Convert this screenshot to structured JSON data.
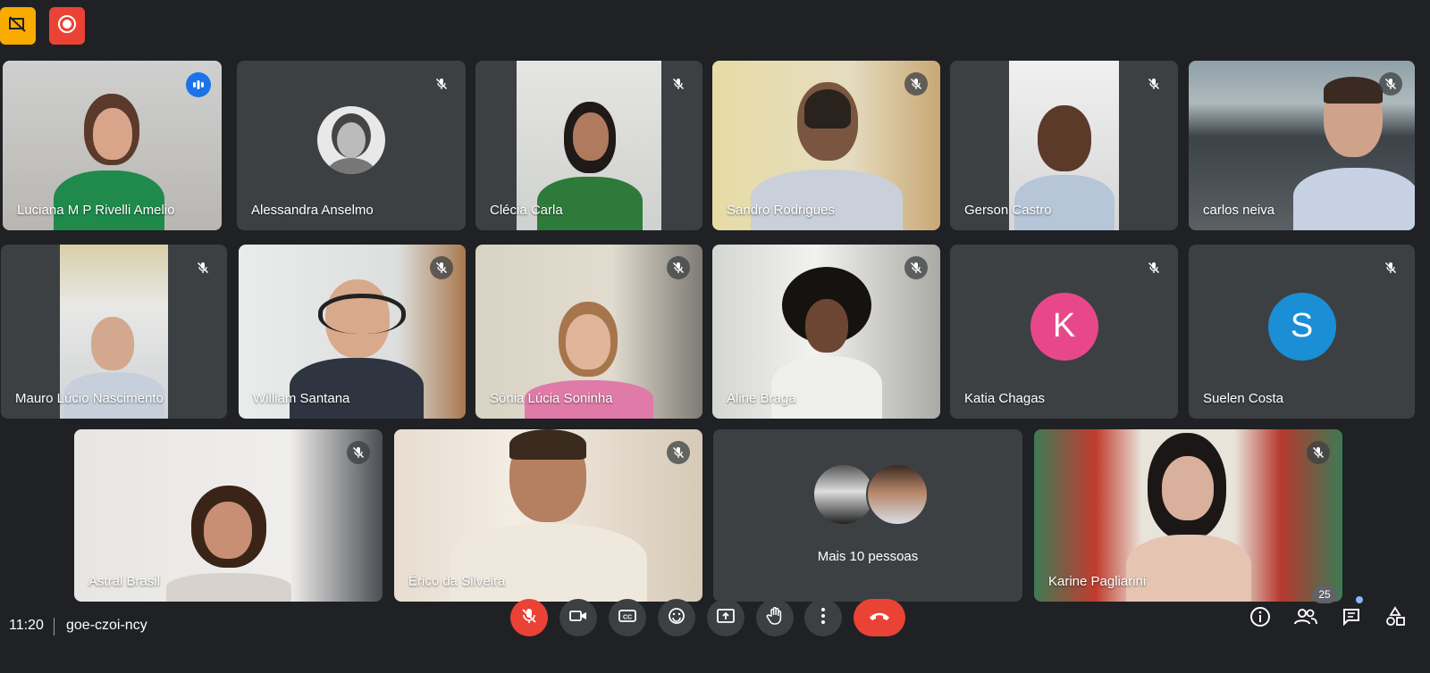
{
  "participants": {
    "luciana": "Luciana M P Rivelli Amelio",
    "alessandra": "Alessandra Anselmo",
    "clecia": "Clécia Carla",
    "sandro": "Sandro Rodrigues",
    "gerson": "Gerson Castro",
    "carlos": "carlos neiva",
    "mauro": "Mauro Lúcio Nascimento",
    "william": "William Santana",
    "sonia": "Sônia Lúcia Soninha",
    "aline": "Aline Braga",
    "katia": "Katia Chagas",
    "suelen": "Suelen Costa",
    "astral": "Astral Brasil",
    "erico": "Érico da Silveira",
    "karine": "Karine Pagliarini"
  },
  "initials": {
    "katia": "K",
    "suelen": "S"
  },
  "more_people": "Mais 10 pessoas",
  "footer": {
    "time": "11:20",
    "code": "goe-czoi-ncy",
    "people_count": "25"
  },
  "colors": {
    "background": "#202124",
    "tile": "#3c4043",
    "active_border": "#8ab4f8",
    "katia_avatar": "#e8488a",
    "suelen_avatar": "#1a8fd6",
    "danger": "#ea4335"
  },
  "icons": {
    "top_left": [
      "no-presenting-icon",
      "recording-icon"
    ],
    "controls": [
      "mic-off-icon",
      "camera-icon",
      "captions-icon",
      "emoji-icon",
      "present-icon",
      "raise-hand-icon",
      "more-options-icon",
      "hang-up-icon"
    ],
    "right": [
      "info-icon",
      "people-icon",
      "chat-icon",
      "activities-icon"
    ]
  }
}
